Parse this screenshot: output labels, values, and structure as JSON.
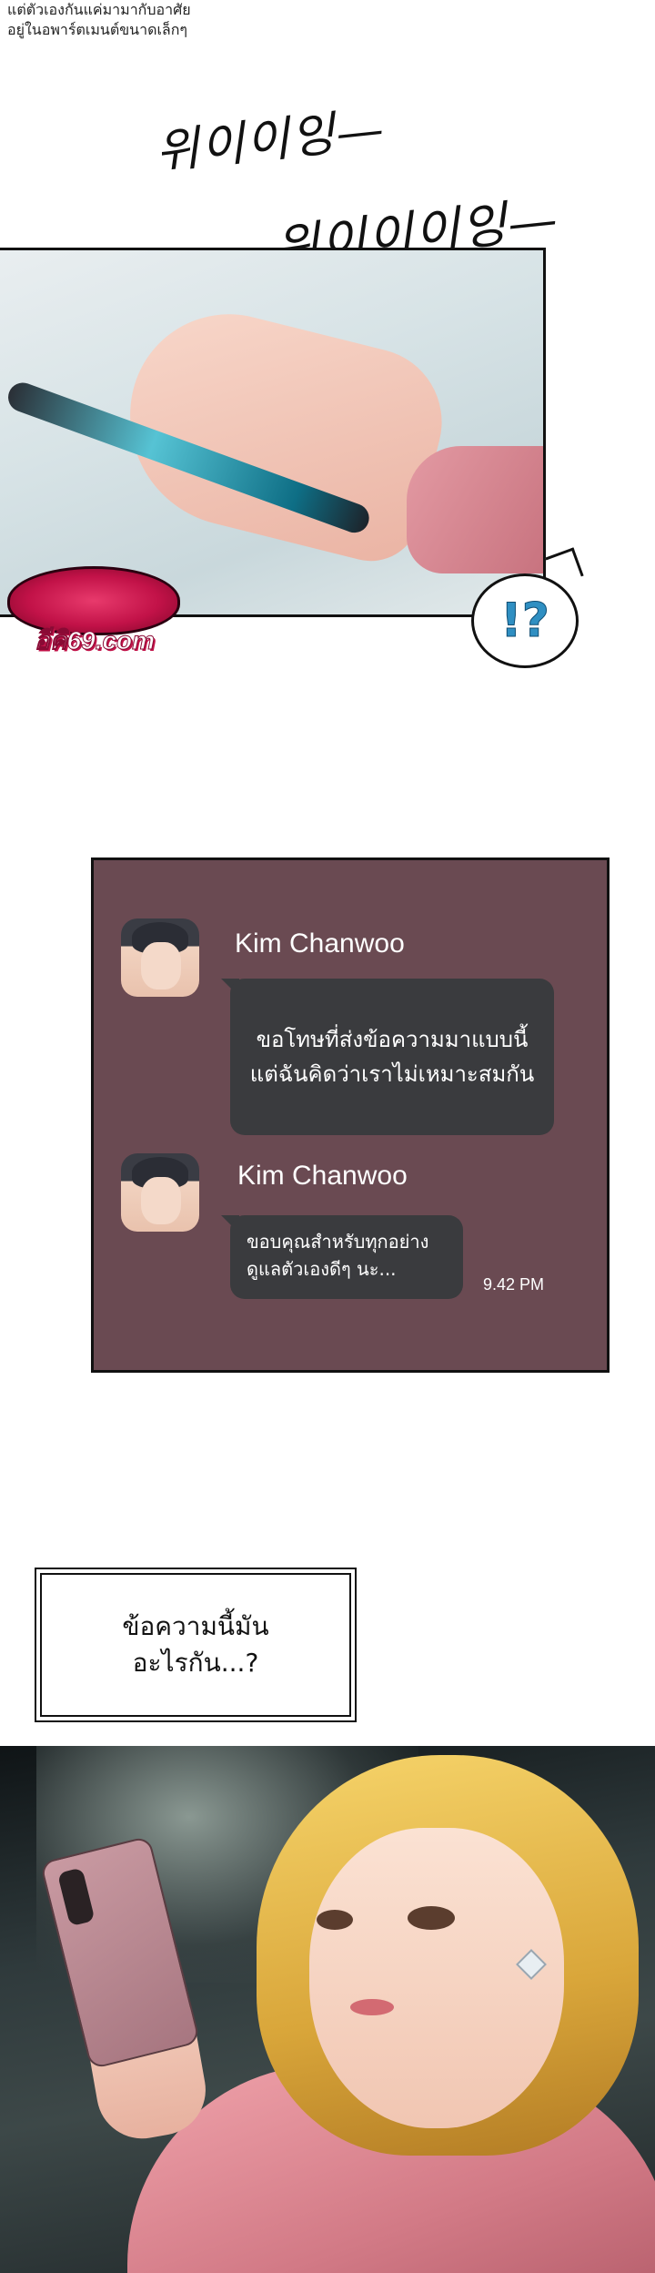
{
  "caption": {
    "line1": "แต่ตัวเองกันแค่มามากับอาศัย",
    "line2": "อยู่ในอพาร์ตเมนต์ขนาดเล็กๆ"
  },
  "sfx": {
    "first": "위이이잉—",
    "second": "위이이이잉—"
  },
  "logo": {
    "text": "อีคิ69.com"
  },
  "reaction": {
    "text": "!?"
  },
  "chat": {
    "messages": [
      {
        "sender": "Kim Chanwoo",
        "line1": "ขอโทษที่ส่งข้อความมาแบบนี้",
        "line2": "แต่ฉันคิดว่าเราไม่เหมาะสมกัน"
      },
      {
        "sender": "Kim Chanwoo",
        "line1": "ขอบคุณสำหรับทุกอย่าง",
        "line2": "ดูแลตัวเองดีๆ นะ...",
        "time": "9.42 PM"
      }
    ]
  },
  "narration": {
    "line1": "ข้อความนี้มัน",
    "line2": "อะไรกัน...?"
  }
}
